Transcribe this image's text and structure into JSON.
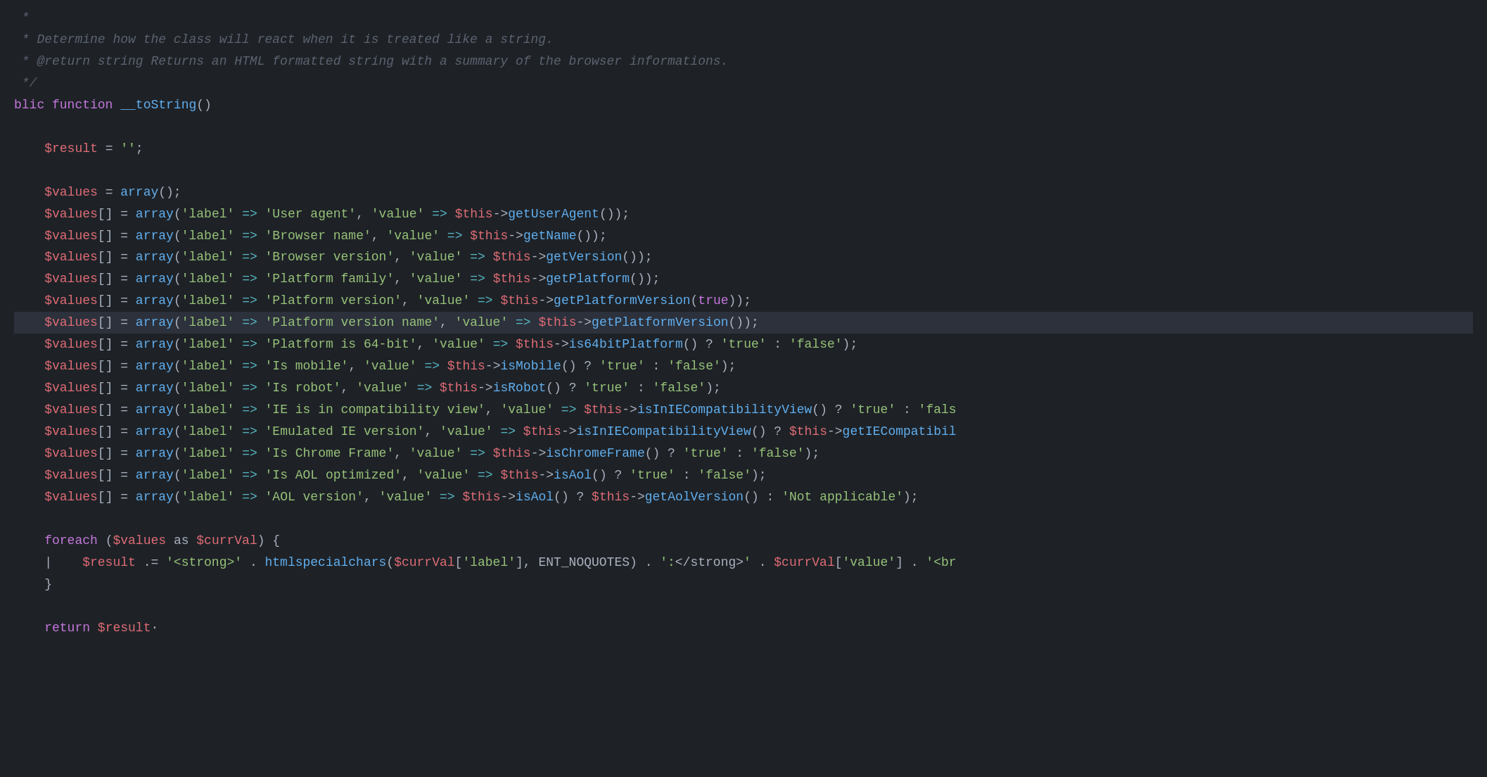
{
  "code": {
    "lines": [
      {
        "id": 1,
        "content": " *",
        "type": "comment"
      },
      {
        "id": 2,
        "content": " * Determine how the class will react when it is treated like a string.",
        "type": "comment"
      },
      {
        "id": 3,
        "content": " * @return string Returns an HTML formatted string with a summary of the browser informations.",
        "type": "comment"
      },
      {
        "id": 4,
        "content": " */",
        "type": "comment"
      },
      {
        "id": 5,
        "content": "blic function __toString()",
        "type": "code"
      },
      {
        "id": 6,
        "content": "",
        "type": "blank"
      },
      {
        "id": 7,
        "content": "    $result = '';",
        "type": "code"
      },
      {
        "id": 8,
        "content": "",
        "type": "blank"
      },
      {
        "id": 9,
        "content": "    $values = array();",
        "type": "code"
      },
      {
        "id": 10,
        "content": "    $values[] = array('label' => 'User agent', 'value' => $this->getUserAgent());",
        "type": "code"
      },
      {
        "id": 11,
        "content": "    $values[] = array('label' => 'Browser name', 'value' => $this->getName());",
        "type": "code"
      },
      {
        "id": 12,
        "content": "    $values[] = array('label' => 'Browser version', 'value' => $this->getVersion());",
        "type": "code"
      },
      {
        "id": 13,
        "content": "    $values[] = array('label' => 'Platform family', 'value' => $this->getPlatform());",
        "type": "code"
      },
      {
        "id": 14,
        "content": "    $values[] = array('label' => 'Platform version', 'value' => $this->getPlatformVersion(true));",
        "type": "code"
      },
      {
        "id": 15,
        "content": "    $values[] = array('label' => 'Platform version name', 'value' => $this->getPlatformVersion());",
        "type": "code",
        "cursor": true
      },
      {
        "id": 16,
        "content": "    $values[] = array('label' => 'Platform is 64-bit', 'value' => $this->is64bitPlatform() ? 'true' : 'false');",
        "type": "code"
      },
      {
        "id": 17,
        "content": "    $values[] = array('label' => 'Is mobile', 'value' => $this->isMobile() ? 'true' : 'false');",
        "type": "code"
      },
      {
        "id": 18,
        "content": "    $values[] = array('label' => 'Is robot', 'value' => $this->isRobot() ? 'true' : 'false');",
        "type": "code"
      },
      {
        "id": 19,
        "content": "    $values[] = array('label' => 'IE is in compatibility view', 'value' => $this->isInIECompatibilityView() ? 'true' : 'fals",
        "type": "code"
      },
      {
        "id": 20,
        "content": "    $values[] = array('label' => 'Emulated IE version', 'value' => $this->isInIECompatibilityView() ? $this->getIECompatibil",
        "type": "code"
      },
      {
        "id": 21,
        "content": "    $values[] = array('label' => 'Is Chrome Frame', 'value' => $this->isChromeFrame() ? 'true' : 'false');",
        "type": "code"
      },
      {
        "id": 22,
        "content": "    $values[] = array('label' => 'Is AOL optimized', 'value' => $this->isAol() ? 'true' : 'false');",
        "type": "code"
      },
      {
        "id": 23,
        "content": "    $values[] = array('label' => 'AOL version', 'value' => $this->isAol() ? $this->getAolVersion() : 'Not applicable');",
        "type": "code"
      },
      {
        "id": 24,
        "content": "",
        "type": "blank"
      },
      {
        "id": 25,
        "content": "    foreach ($values as $currVal) {",
        "type": "code"
      },
      {
        "id": 26,
        "content": "        $result .= '<strong>' . htmlspecialchars($currVal['label'], ENT_NOQUOTES) . ':</strong> ' . $currVal['value'] . '<br",
        "type": "code"
      },
      {
        "id": 27,
        "content": "    }",
        "type": "code"
      },
      {
        "id": 28,
        "content": "",
        "type": "blank"
      },
      {
        "id": 29,
        "content": "    return $result",
        "type": "code"
      }
    ]
  }
}
